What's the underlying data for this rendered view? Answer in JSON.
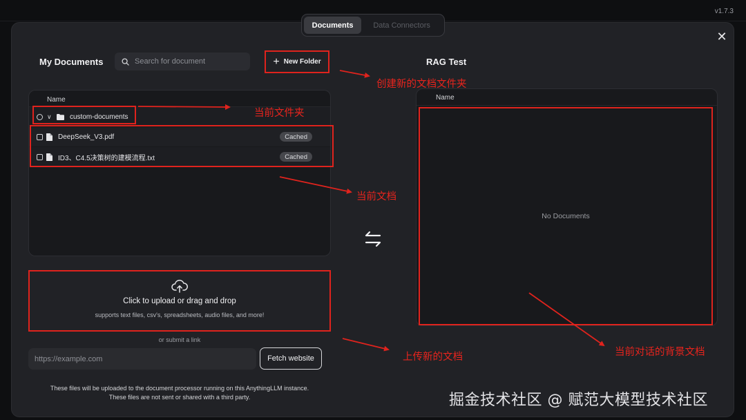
{
  "version": "v1.7.3",
  "tabs": [
    {
      "label": "Documents",
      "active": true
    },
    {
      "label": "Data Connectors",
      "active": false
    }
  ],
  "close_icon": "close-icon",
  "left": {
    "title": "My Documents",
    "search_placeholder": "Search for document",
    "new_folder_label": "New Folder",
    "column_name": "Name",
    "folder": {
      "name": "custom-documents",
      "icon": "folder-icon"
    },
    "files": [
      {
        "name": "DeepSeek_V3.pdf",
        "status": "Cached",
        "icon": "file-icon"
      },
      {
        "name": "ID3、C4.5决策树的建模流程.txt",
        "status": "Cached",
        "icon": "file-icon"
      }
    ]
  },
  "upload": {
    "title": "Click to upload or drag and drop",
    "subtitle": "supports text files, csv's, spreadsheets, audio files, and more!",
    "or_link": "or submit a link",
    "url_placeholder": "https://example.com",
    "fetch_label": "Fetch website",
    "notice_line1": "These files will be uploaded to the document processor running on this AnythingLLM instance.",
    "notice_line2": "These files are not sent or shared with a third party."
  },
  "right": {
    "title": "RAG Test",
    "column_name": "Name",
    "empty": "No Documents"
  },
  "annotations": {
    "new_folder": "创建新的文档文件夹",
    "current_folder": "当前文件夹",
    "current_docs": "当前文档",
    "upload_new": "上传新的文档",
    "background_docs": "当前对话的背景文档",
    "color": "#e0231d"
  },
  "watermark": "掘金技术社区 @ 赋范大模型技术社区"
}
